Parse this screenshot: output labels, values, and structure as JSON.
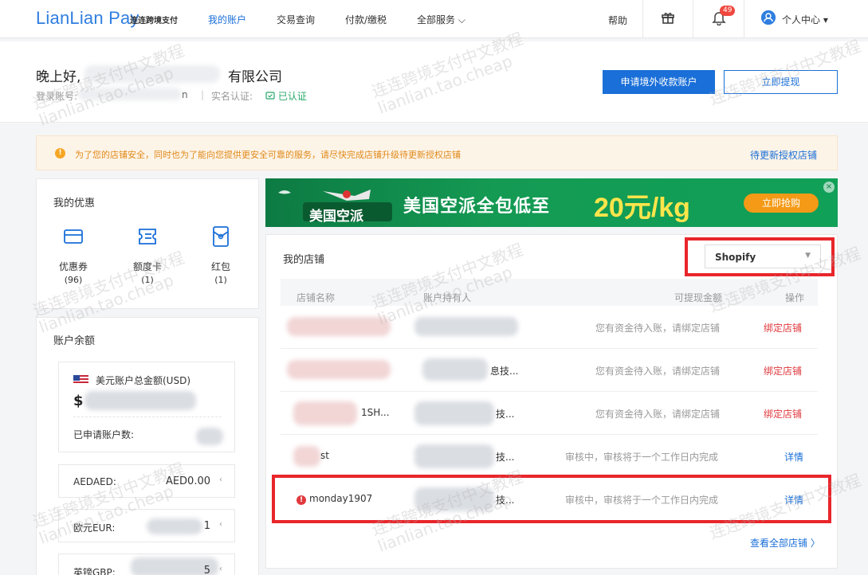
{
  "nav": {
    "logo": "LianLian Pay",
    "logo_sub": "连连跨境支付",
    "items": [
      "我的账户",
      "交易查询",
      "付款/缴税",
      "全部服务 ⌵"
    ],
    "help": "帮助",
    "notification_count": "49",
    "user_menu": "个人中心 ▾",
    "icons": [
      "gift-icon",
      "bell-icon",
      "user-icon"
    ]
  },
  "greeting": {
    "title": "晚上好,",
    "company_suffix": "有限公司",
    "account_label": "登录账号:",
    "account_tail": "n",
    "separator": "|",
    "realname_label": "实名认证:",
    "verified": "已认证",
    "apply_button": "申请境外收款账户",
    "withdraw_button": "立即提现"
  },
  "notice": {
    "text": "为了您的店铺安全，同时也为了能向您提供更安全可靠的服务，请尽快完成店铺升级待更新授权店铺",
    "link": "待更新授权店铺"
  },
  "offers": {
    "title": "我的优惠",
    "items": [
      {
        "label": "优惠券",
        "count": "(96)",
        "icon": "coupon-icon"
      },
      {
        "label": "额度卡",
        "count": "(1)",
        "icon": "quota-card-icon"
      },
      {
        "label": "红包",
        "count": "(1)",
        "icon": "red-packet-icon"
      }
    ]
  },
  "balance": {
    "title": "账户余额",
    "usd_title": "美元账户总金额(USD)",
    "usd_prefix": "$",
    "applied_label": "已申请账户数:",
    "currencies": [
      {
        "name": "AEDAED:",
        "value": "AED0.00"
      },
      {
        "name": "欧元EUR:",
        "value": "1"
      },
      {
        "name": "英镑GBP:",
        "value": "5"
      }
    ]
  },
  "banner": {
    "logo_text": "美国空派",
    "text": "美国空派全包低至",
    "price": "20元/kg",
    "button": "立即抢购",
    "close": "×"
  },
  "stores": {
    "title": "我的店铺",
    "platform_selected": "Shopify",
    "columns": [
      "店铺名称",
      "账户持有人",
      "可提现金额",
      "操作"
    ],
    "rows": [
      {
        "name": "",
        "holder": "",
        "amount": "您有资金待入账，请绑定店铺",
        "action": "绑定店铺",
        "action_type": "red"
      },
      {
        "name": "",
        "holder": "息技...",
        "amount": "您有资金待入账，请绑定店铺",
        "action": "绑定店铺",
        "action_type": "red"
      },
      {
        "name": "1SH...",
        "holder": "技...",
        "amount": "您有资金待入账，请绑定店铺",
        "action": "绑定店铺",
        "action_type": "red"
      },
      {
        "name": "st",
        "holder": "技...",
        "amount": "审核中，审核将于一个工作日内完成",
        "action": "详情",
        "action_type": "blue"
      },
      {
        "name": "monday1907",
        "holder": "技...",
        "amount": "审核中，审核将于一个工作日内完成",
        "action": "详情",
        "action_type": "blue",
        "warning": true
      }
    ],
    "view_all": "查看全部店铺 〉"
  },
  "watermark": {
    "line1": "连连跨境支付中文教程",
    "line2": "lianlian.tao.cheap"
  },
  "colors": {
    "accent": "#1a6fd8",
    "danger": "#e0393e",
    "highlight_box": "#e8262b",
    "banner_green": "#149a53"
  }
}
